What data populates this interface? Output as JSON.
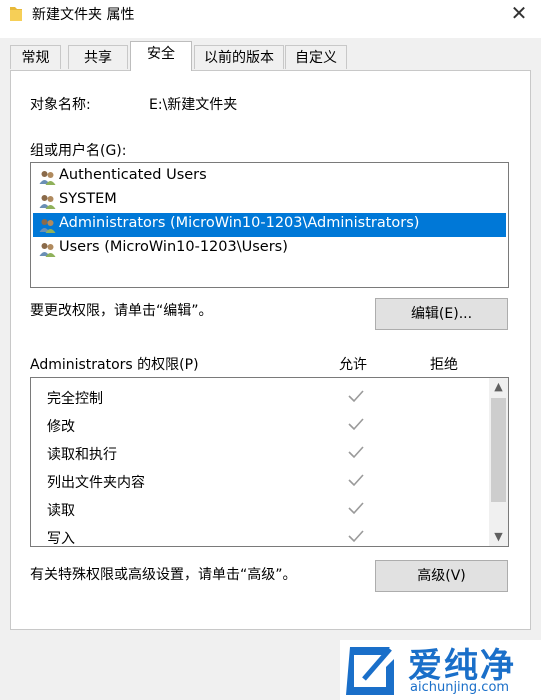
{
  "window": {
    "title": "新建文件夹 属性",
    "close_glyph": "✕"
  },
  "tabs": [
    {
      "label": "常规"
    },
    {
      "label": "共享"
    },
    {
      "label": "安全",
      "active": true
    },
    {
      "label": "以前的版本"
    },
    {
      "label": "自定义"
    }
  ],
  "object": {
    "label": "对象名称:",
    "value": "E:\\新建文件夹"
  },
  "groups": {
    "label": "组或用户名(G):",
    "items": [
      {
        "name": "Authenticated Users"
      },
      {
        "name": "SYSTEM"
      },
      {
        "name": "Administrators (MicroWin10-1203\\Administrators)",
        "selected": true
      },
      {
        "name": "Users (MicroWin10-1203\\Users)"
      }
    ]
  },
  "edit": {
    "hint": "要更改权限，请单击“编辑”。",
    "button": "编辑(E)..."
  },
  "permissions": {
    "label": "Administrators 的权限(P)",
    "allow_header": "允许",
    "deny_header": "拒绝",
    "rows": [
      {
        "name": "完全控制",
        "allow": true,
        "deny": false
      },
      {
        "name": "修改",
        "allow": true,
        "deny": false
      },
      {
        "name": "读取和执行",
        "allow": true,
        "deny": false
      },
      {
        "name": "列出文件夹内容",
        "allow": true,
        "deny": false
      },
      {
        "name": "读取",
        "allow": true,
        "deny": false
      },
      {
        "name": "写入",
        "allow": true,
        "deny": false
      }
    ]
  },
  "advanced": {
    "hint": "有关特殊权限或高级设置，请单击“高级”。",
    "button": "高级(V)"
  },
  "watermark": {
    "text": "爱纯净",
    "url": "aichunjing.com"
  },
  "colors": {
    "selection": "#0078d7",
    "watermark_blue": "#1a6fc9",
    "check_gray": "#9a9a9a"
  }
}
